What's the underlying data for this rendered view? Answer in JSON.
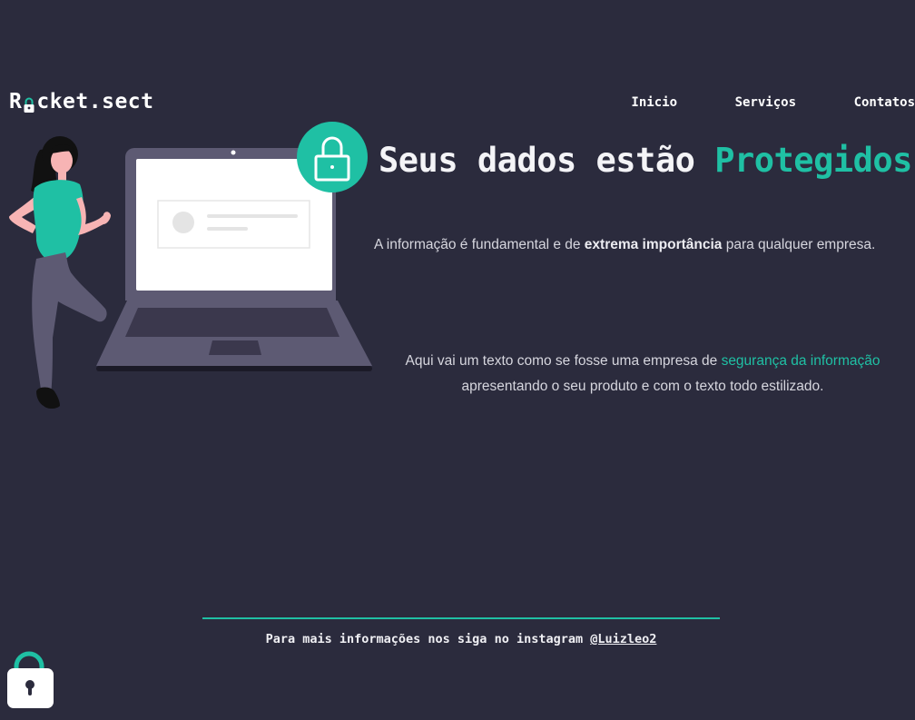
{
  "header": {
    "logo_prefix": "R",
    "logo_suffix": "cket.sect",
    "nav": [
      {
        "label": "Inicio"
      },
      {
        "label": "Serviços"
      },
      {
        "label": "Contatos"
      }
    ]
  },
  "hero": {
    "title_main": "Seus dados estão ",
    "title_accent": "Protegidos",
    "paragraph1": {
      "before": "A informação é fundamental e de ",
      "bold": "extrema importância",
      "after": " para qualquer empresa."
    },
    "paragraph2": {
      "before": "Aqui vai um texto como se fosse uma empresa de ",
      "accent": "segurança da informação",
      "after": " apresentando o seu produto e com o texto todo estilizado."
    }
  },
  "footer": {
    "text": "Para mais informações nos siga no instagram ",
    "handle": "@Luizleo2"
  },
  "colors": {
    "background": "#2b2b3d",
    "accent": "#1fc0a4",
    "text": "#ffffff"
  },
  "icons": [
    "padlock-icon",
    "woman-illustration",
    "laptop-illustration",
    "floating-lock-icon"
  ]
}
